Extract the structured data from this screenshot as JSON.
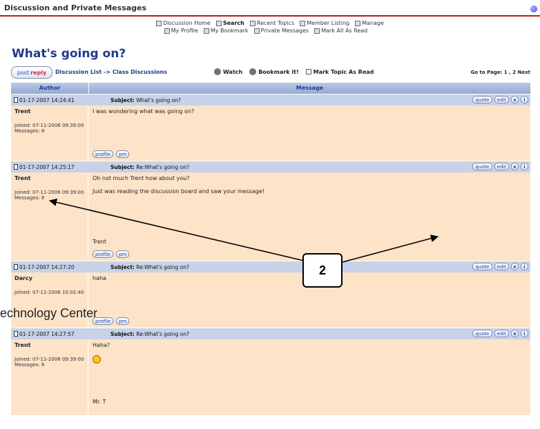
{
  "app": {
    "title": "Discussion and Private Messages"
  },
  "nav": {
    "row1": [
      "Discussion Home",
      "Search",
      "Recent Topics",
      "Member Listing",
      "Manage"
    ],
    "row2": [
      "My Profile",
      "My Bookmark",
      "Private Messages",
      "Mark All As Read"
    ]
  },
  "page": {
    "heading": "What's going on?"
  },
  "toolbar": {
    "post_label_1": "post",
    "post_label_2": "reply",
    "breadcrumb": "Discussion List -> Class Discussions",
    "watch": "Watch",
    "bookmark": "Bookmark it!",
    "mark_read": "Mark Topic As Read",
    "pager": "Go to Page: 1 , 2  Next"
  },
  "table": {
    "author_header": "Author",
    "message_header": "Message"
  },
  "buttons": {
    "quote": "quote",
    "edit": "edit",
    "delete": "x",
    "ip": "i",
    "profile": "profile",
    "pm": "pm"
  },
  "subject_label": "Subject:",
  "posts": [
    {
      "date": "01-17-2007 14:24:41",
      "subject": "What's going on?",
      "author": "Trent",
      "joined": "Joined: 07-11-2006 09:39:00",
      "messages": "Messages: 8",
      "lines": [
        "I was wondering what was going on?"
      ]
    },
    {
      "date": "01-17-2007 14:25:17",
      "subject": "Re:What's going on?",
      "author": "Trent",
      "joined": "Joined: 07-11-2006 09:39:00",
      "messages": "Messages: 8",
      "lines": [
        "Oh not much Trent how about you?",
        "Just was reading the discussion board and saw your message!",
        "Trent"
      ]
    },
    {
      "date": "01-17-2007 14:27:20",
      "subject": "Re:What's going on?",
      "author": "Darcy",
      "joined": "Joined: 07-11-2006 10:02:40",
      "messages": "",
      "lines": [
        "haha"
      ]
    },
    {
      "date": "01-17-2007 14:27:57",
      "subject": "Re:What's going on?",
      "author": "Trent",
      "joined": "Joined: 07-11-2006 09:39:00",
      "messages": "Messages: 8",
      "lines": [
        "Haha?",
        "",
        "Mr. T"
      ]
    }
  ],
  "overlay": {
    "watermark": "echnology Center",
    "callout": "2"
  }
}
